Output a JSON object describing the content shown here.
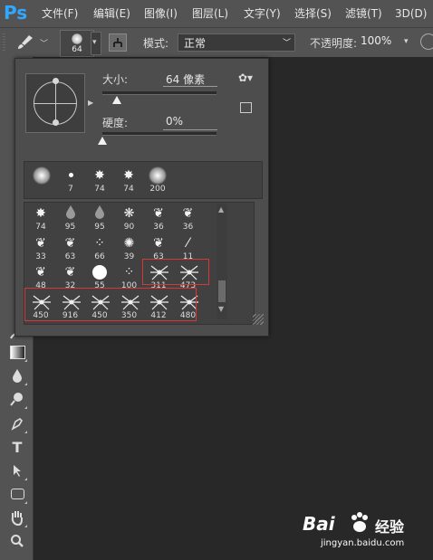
{
  "app": {
    "logo": "Ps"
  },
  "menu": [
    {
      "label": "文件(F)"
    },
    {
      "label": "编辑(E)"
    },
    {
      "label": "图像(I)"
    },
    {
      "label": "图层(L)"
    },
    {
      "label": "文字(Y)"
    },
    {
      "label": "选择(S)"
    },
    {
      "label": "滤镜(T)"
    },
    {
      "label": "3D(D)"
    }
  ],
  "options_bar": {
    "brush_preset_size": "64",
    "mode_label": "模式:",
    "mode_value": "正常",
    "opacity_label": "不透明度:",
    "opacity_value": "100%"
  },
  "brush_panel": {
    "size_label": "大小:",
    "size_value": "64 像素",
    "size_slider": 0.13,
    "hardness_label": "硬度:",
    "hardness_value": "0%",
    "hardness_slider": 0.0,
    "recent_brushes": [
      {
        "label": "",
        "icon": "soft-round"
      },
      {
        "label": "7",
        "icon": "small-dot"
      },
      {
        "label": "74",
        "icon": "leaf-star"
      },
      {
        "label": "74",
        "icon": "leaf-star"
      },
      {
        "label": "200",
        "icon": "soft-round"
      }
    ],
    "brush_rows": [
      [
        {
          "label": "74",
          "icon": "leaf-star"
        },
        {
          "label": "95",
          "icon": "drop"
        },
        {
          "label": "95",
          "icon": "drop"
        },
        {
          "label": "90",
          "icon": "scatter"
        },
        {
          "label": "36",
          "icon": "grass"
        },
        {
          "label": "36",
          "icon": "grass"
        }
      ],
      [
        {
          "label": "33",
          "icon": "grass"
        },
        {
          "label": "63",
          "icon": "grass"
        },
        {
          "label": "66",
          "icon": "speckle"
        },
        {
          "label": "39",
          "icon": "star-scatter"
        },
        {
          "label": "63",
          "icon": "grass"
        },
        {
          "label": "11",
          "icon": "stroke"
        }
      ],
      [
        {
          "label": "48",
          "icon": "grass"
        },
        {
          "label": "32",
          "icon": "grass"
        },
        {
          "label": "55",
          "icon": "hard-round"
        },
        {
          "label": "100",
          "icon": "speckle"
        },
        {
          "label": "311",
          "icon": "spider"
        },
        {
          "label": "473",
          "icon": "spider"
        }
      ],
      [
        {
          "label": "450",
          "icon": "spider"
        },
        {
          "label": "916",
          "icon": "spider"
        },
        {
          "label": "450",
          "icon": "spider"
        },
        {
          "label": "350",
          "icon": "spider"
        },
        {
          "label": "412",
          "icon": "spider"
        },
        {
          "label": "480",
          "icon": "spider"
        }
      ]
    ],
    "highlight_color": "#d63838"
  },
  "toolbox": {
    "tools": [
      {
        "icon": "blur-icon"
      },
      {
        "icon": "gradient-icon"
      },
      {
        "icon": "drop-icon"
      },
      {
        "icon": "dodge-icon"
      },
      {
        "icon": "pen-icon"
      },
      {
        "icon": "type-icon",
        "glyph": "T"
      },
      {
        "icon": "path-select-icon"
      },
      {
        "icon": "rectangle-icon"
      },
      {
        "icon": "hand-icon"
      },
      {
        "icon": "zoom-icon"
      }
    ]
  },
  "watermark": {
    "brand": "Bai",
    "brand2": "经验",
    "url": "jingyan.baidu.com"
  }
}
